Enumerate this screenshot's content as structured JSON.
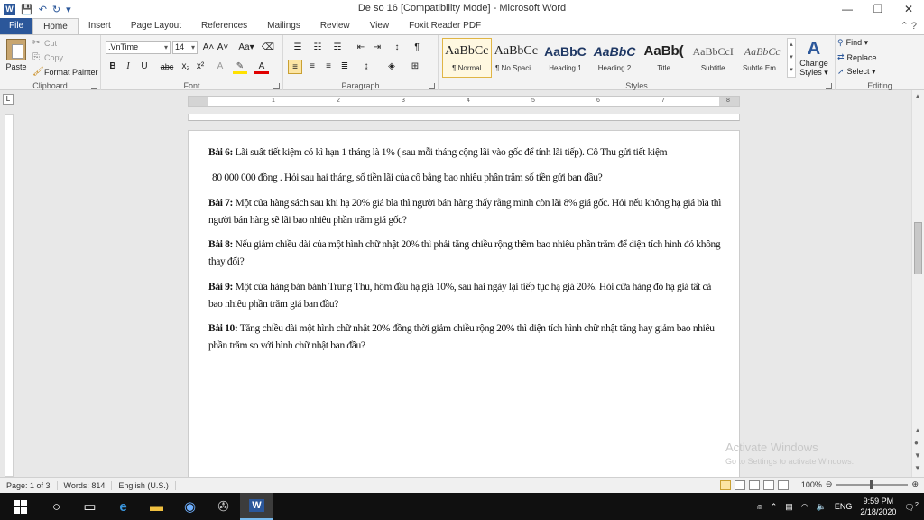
{
  "window": {
    "title": "De so 16 [Compatibility Mode]  -  Microsoft Word",
    "minimize_glyph": "—",
    "restore_glyph": "❐",
    "close_glyph": "✕"
  },
  "tabs": [
    "File",
    "Home",
    "Insert",
    "Page Layout",
    "References",
    "Mailings",
    "Review",
    "View",
    "Foxit Reader PDF"
  ],
  "active_tab": "Home",
  "ribbon": {
    "clipboard": {
      "label": "Clipboard",
      "paste": "Paste",
      "cut": "Cut",
      "copy": "Copy",
      "format_painter": "Format Painter"
    },
    "font": {
      "label": "Font",
      "font_name": ".VnTime",
      "font_size": "14",
      "grow": "A˄",
      "shrink": "A˅",
      "change_case": "Aa▾",
      "bold": "B",
      "italic": "I",
      "underline": "U",
      "strike": "abc",
      "subscript": "x₂",
      "superscript": "x²"
    },
    "paragraph": {
      "label": "Paragraph"
    },
    "styles": {
      "label": "Styles",
      "items": [
        {
          "preview": "AaBbCc",
          "name": "¶ Normal"
        },
        {
          "preview": "AaBbCc",
          "name": "¶ No Spaci..."
        },
        {
          "preview": "AaBbC",
          "name": "Heading 1"
        },
        {
          "preview": "AaBbC",
          "name": "Heading 2"
        },
        {
          "preview": "AaBb(",
          "name": "Title"
        },
        {
          "preview": "AaBbCcI",
          "name": "Subtitle"
        },
        {
          "preview": "AaBbCc",
          "name": "Subtle Em..."
        }
      ],
      "change_styles": "Change Styles ▾"
    },
    "editing": {
      "label": "Editing",
      "find": "Find ▾",
      "replace": "Replace",
      "select": "Select ▾"
    }
  },
  "ruler": {
    "ticks": [
      "1",
      "2",
      "3",
      "4",
      "5",
      "6",
      "7",
      "8"
    ]
  },
  "document": {
    "paragraphs": [
      {
        "label": "Bài 6:",
        "text": " Lãi suất tiết kiệm có kì hạn 1 tháng là 1% ( sau mỗi tháng cộng lãi vào gốc để tính lãi tiếp). Cô Thu gửi tiết kiệm"
      },
      {
        "label": "",
        "text": "80 000 000 đồng . Hỏi sau hai tháng, số tiền lãi của cô bằng bao nhiêu phần trăm số tiền gửi ban đầu?"
      },
      {
        "label": "Bài 7:",
        "text": " Một cửa hàng sách sau khi hạ 20% giá bìa thì người bán hàng thấy rằng mình còn lãi 8% giá gốc. Hỏi nếu không hạ giá bìa thì người bán hàng sẽ lãi bao nhiêu phần trăm giá gốc?"
      },
      {
        "label": "Bài 8:",
        "text": " Nếu giảm chiều dài của một hình chữ nhật 20% thì phải tăng chiều rộng thêm bao nhiêu phần trăm để diện tích hình đó không thay đổi?"
      },
      {
        "label": "Bài 9:",
        "text": " Một cửa hàng bán bánh Trung Thu, hôm đầu hạ giá 10%, sau hai ngày lại tiếp tục hạ giá 20%. Hỏi cửa hàng đó hạ giá tất cả bao nhiêu phần trăm giá ban đầu?"
      },
      {
        "label": "Bài 10:",
        "text": " Tăng chiều dài một hình chữ nhật 20% đồng thời giảm chiều rộng 20% thì diện tích hình chữ nhật tăng hay giảm bao nhiêu phần trăm so với hình chữ nhật ban đầu?"
      }
    ]
  },
  "watermark": {
    "line1": "Activate Windows",
    "line2": "Go to Settings to activate Windows."
  },
  "statusbar": {
    "page": "Page: 1 of 3",
    "words": "Words: 814",
    "language": "English (U.S.)",
    "zoom": "100%"
  },
  "taskbar": {
    "time": "9:59 PM",
    "date": "2/18/2020",
    "language": "ENG",
    "notifications": "2"
  },
  "colors": {
    "accent": "#2b579a",
    "ribbon_bg": "#f3f3f3",
    "taskbar_bg": "#101010"
  }
}
